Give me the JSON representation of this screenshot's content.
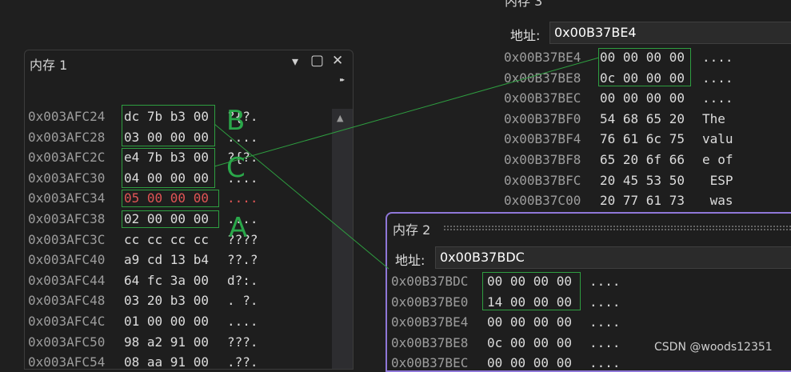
{
  "accent_green": "#2e9e40",
  "highlight_red": "#e05555",
  "mem1": {
    "title": "内存 1",
    "rows": [
      {
        "addr": "0x003AFC24",
        "bytes": "dc 7b b3 00",
        "ascii": "?{?."
      },
      {
        "addr": "0x003AFC28",
        "bytes": "03 00 00 00",
        "ascii": "...."
      },
      {
        "addr": "0x003AFC2C",
        "bytes": "e4 7b b3 00",
        "ascii": "?{?."
      },
      {
        "addr": "0x003AFC30",
        "bytes": "04 00 00 00",
        "ascii": "...."
      },
      {
        "addr": "0x003AFC34",
        "bytes": "05 00 00 00",
        "ascii": "...."
      },
      {
        "addr": "0x003AFC38",
        "bytes": "02 00 00 00",
        "ascii": "...."
      },
      {
        "addr": "0x003AFC3C",
        "bytes": "cc cc cc cc",
        "ascii": "????"
      },
      {
        "addr": "0x003AFC40",
        "bytes": "a9 cd 13 b4",
        "ascii": "??.?"
      },
      {
        "addr": "0x003AFC44",
        "bytes": "64 fc 3a 00",
        "ascii": "d?:."
      },
      {
        "addr": "0x003AFC48",
        "bytes": "03 20 b3 00",
        "ascii": ". ?."
      },
      {
        "addr": "0x003AFC4C",
        "bytes": "01 00 00 00",
        "ascii": "...."
      },
      {
        "addr": "0x003AFC50",
        "bytes": "98 a2 91 00",
        "ascii": "???."
      },
      {
        "addr": "0x003AFC54",
        "bytes": "08 aa 91 00",
        "ascii": ".??."
      }
    ]
  },
  "mem3": {
    "title": "内存 3",
    "address_label": "地址:",
    "address_value": "0x00B37BE4",
    "rows": [
      {
        "addr": "0x00B37BE4",
        "bytes": "00 00 00 00",
        "ascii": "...."
      },
      {
        "addr": "0x00B37BE8",
        "bytes": "0c 00 00 00",
        "ascii": "...."
      },
      {
        "addr": "0x00B37BEC",
        "bytes": "00 00 00 00",
        "ascii": "...."
      },
      {
        "addr": "0x00B37BF0",
        "bytes": "54 68 65 20",
        "ascii": "The "
      },
      {
        "addr": "0x00B37BF4",
        "bytes": "76 61 6c 75",
        "ascii": "valu"
      },
      {
        "addr": "0x00B37BF8",
        "bytes": "65 20 6f 66",
        "ascii": "e of"
      },
      {
        "addr": "0x00B37BFC",
        "bytes": "20 45 53 50",
        "ascii": " ESP"
      },
      {
        "addr": "0x00B37C00",
        "bytes": "20 77 61 73",
        "ascii": " was"
      }
    ]
  },
  "mem2": {
    "title": "内存 2",
    "address_label": "地址:",
    "address_value": "0x00B37BDC",
    "rows": [
      {
        "addr": "0x00B37BDC",
        "bytes": "00 00 00 00",
        "ascii": "...."
      },
      {
        "addr": "0x00B37BE0",
        "bytes": "14 00 00 00",
        "ascii": "...."
      },
      {
        "addr": "0x00B37BE4",
        "bytes": "00 00 00 00",
        "ascii": "...."
      },
      {
        "addr": "0x00B37BE8",
        "bytes": "0c 00 00 00",
        "ascii": "...."
      },
      {
        "addr": "0x00B37BEC",
        "bytes": "00 00 00 00",
        "ascii": "...."
      }
    ]
  },
  "annotations": {
    "a": "A",
    "b": "B",
    "c": "C"
  },
  "icons": {
    "dropdown": "▾",
    "maximize": "▢",
    "close": "✕",
    "overflow": "▸▸",
    "scroll_up": "▲"
  },
  "watermark": "CSDN @woods12351"
}
